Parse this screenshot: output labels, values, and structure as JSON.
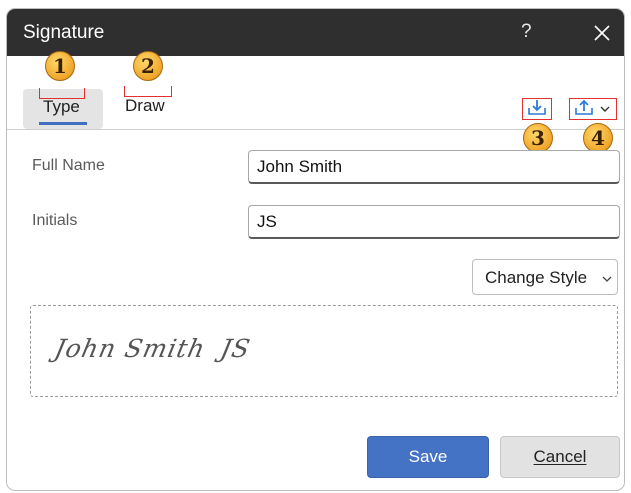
{
  "dialog": {
    "title": "Signature",
    "help_label": "?",
    "close_icon": "close-icon"
  },
  "tabs": [
    {
      "label": "Type",
      "selected": true
    },
    {
      "label": "Draw",
      "selected": false
    }
  ],
  "toolbar": {
    "icons": [
      "download-icon",
      "upload-icon",
      "chevron-down-icon"
    ]
  },
  "badges": [
    "1",
    "2",
    "3",
    "4"
  ],
  "form": {
    "full_name_label": "Full Name",
    "full_name_value": "John Smith",
    "initials_label": "Initials",
    "initials_value": "JS"
  },
  "change_style": {
    "label": "Change Style"
  },
  "preview": {
    "name": "John Smith",
    "initials": "JS"
  },
  "buttons": {
    "save_label": "Save",
    "cancel_label": "Cancel"
  },
  "colors": {
    "titlebar": "#2f2f2f",
    "accent": "#4472c4",
    "annotation_red": "#e03030",
    "badge_gold": "#f0a52a"
  }
}
